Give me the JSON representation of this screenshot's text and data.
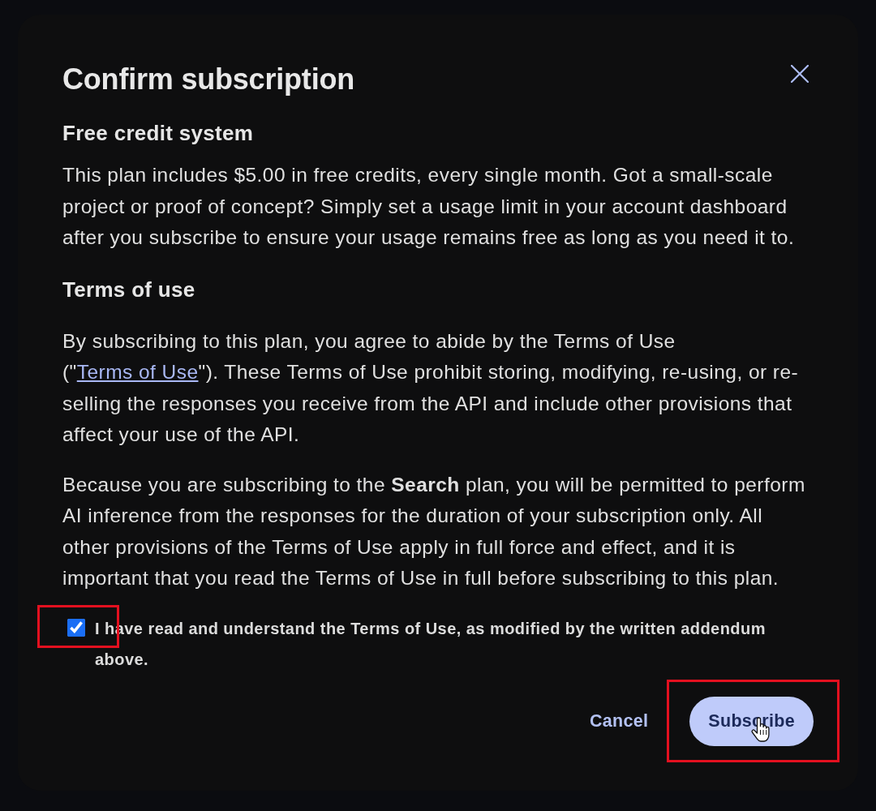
{
  "dialog": {
    "title": "Confirm subscription"
  },
  "sections": [
    {
      "heading": "Free credit system",
      "paragraphs": [
        {
          "segments": [
            {
              "kind": "text",
              "text": "This plan includes $5.00 in free credits, every single month. Got a small-scale project or proof of concept? Simply set a usage limit in your account dashboard after you subscribe to ensure your usage remains free as long as you need it to."
            }
          ]
        }
      ]
    },
    {
      "heading": "Terms of use",
      "paragraphs": [
        {
          "segments": [
            {
              "kind": "text",
              "text": "By subscribing to this plan, you agree to abide by the Terms of Use (\""
            },
            {
              "kind": "link",
              "text": "Terms of Use"
            },
            {
              "kind": "text",
              "text": "\"). These Terms of Use prohibit storing, modifying, re-using, or re-selling the responses you receive from the API and include other provisions that affect your use of the API."
            }
          ]
        },
        {
          "segments": [
            {
              "kind": "text",
              "text": "Because you are subscribing to the **Search** plan, you will be permitted to perform AI inference from the responses for the duration of your subscription only. All other provisions of the Terms of Use apply in full force and effect, and it is important that you read the Terms of Use in full before subscribing to this plan."
            }
          ]
        }
      ]
    }
  ],
  "consent": {
    "label": "I have read and understand the Terms of Use, as modified by the written addendum above.",
    "checked": true,
    "highlighted": true
  },
  "buttons": [
    {
      "label": "Cancel",
      "kind": "text",
      "highlighted": false,
      "hovered": false
    },
    {
      "label": "Subscribe",
      "kind": "filled",
      "highlighted": true,
      "hovered": true
    }
  ]
}
